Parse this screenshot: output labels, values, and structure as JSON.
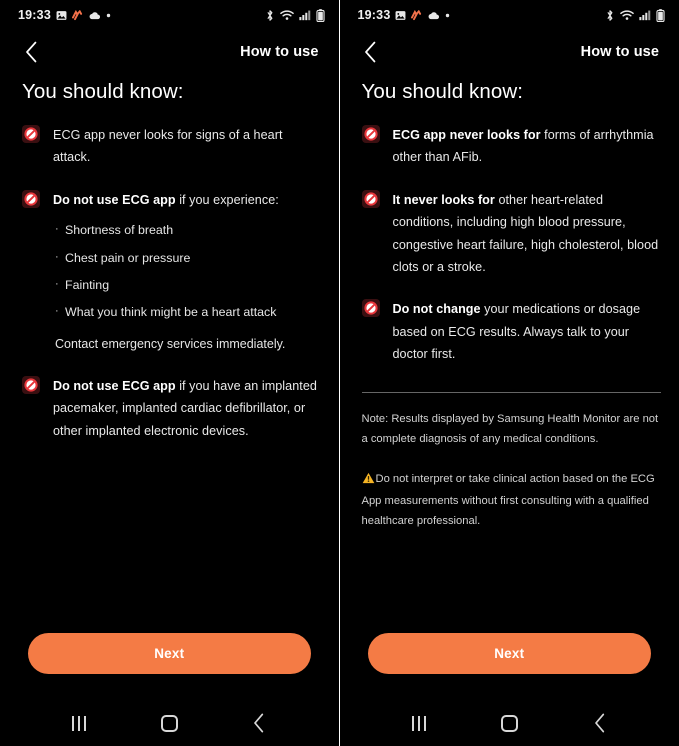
{
  "status_bar": {
    "time": "19:33",
    "left_icons": [
      "image-icon",
      "zigzag-orange-icon",
      "cloud-icon",
      "dot-icon"
    ],
    "right_icons": [
      "bluetooth-icon",
      "wifi-icon",
      "signal-icon",
      "battery-icon"
    ]
  },
  "colors": {
    "background": "#000000",
    "accent_orange": "#F47B45",
    "prohibition_red": "#E8363B",
    "warning_yellow": "#F5B425",
    "text_primary": "#ffffff",
    "text_secondary": "#d2d2d2"
  },
  "screens": [
    {
      "id": "screen-1",
      "header": {
        "back_label": "Back",
        "title": "How to use"
      },
      "page_title": "You should know:",
      "bullets": [
        {
          "icon": "prohibition-icon",
          "segments": [
            {
              "text": "ECG app never looks for signs of a heart attack.",
              "bold": false
            }
          ],
          "sub_items": [],
          "trailing_text": ""
        },
        {
          "icon": "prohibition-icon",
          "segments": [
            {
              "text": "Do not use ECG app ",
              "bold": true
            },
            {
              "text": "if you experience:",
              "bold": false
            }
          ],
          "sub_items": [
            "Shortness of breath",
            "Chest pain or pressure",
            "Fainting",
            "What you think might be a heart attack"
          ],
          "trailing_text": "Contact emergency services immediately."
        },
        {
          "icon": "prohibition-icon",
          "segments": [
            {
              "text": "Do not use ECG app ",
              "bold": true
            },
            {
              "text": "if you have an implanted pacemaker, implanted cardiac defibrillator, or other implanted electronic devices.",
              "bold": false
            }
          ],
          "sub_items": [],
          "trailing_text": ""
        }
      ],
      "divider": false,
      "note": "",
      "warning": "",
      "next_label": "Next"
    },
    {
      "id": "screen-2",
      "header": {
        "back_label": "Back",
        "title": "How to use"
      },
      "page_title": "You should know:",
      "bullets": [
        {
          "icon": "prohibition-icon",
          "segments": [
            {
              "text": "ECG app never looks for ",
              "bold": true
            },
            {
              "text": "forms of arrhythmia other than AFib.",
              "bold": false
            }
          ],
          "sub_items": [],
          "trailing_text": ""
        },
        {
          "icon": "prohibition-icon",
          "segments": [
            {
              "text": "It never looks for ",
              "bold": true
            },
            {
              "text": "other heart-related conditions, including high blood pressure, congestive heart failure, high cholesterol, blood clots or a stroke.",
              "bold": false
            }
          ],
          "sub_items": [],
          "trailing_text": ""
        },
        {
          "icon": "prohibition-icon",
          "segments": [
            {
              "text": "Do not change ",
              "bold": true
            },
            {
              "text": "your medications or dosage based on ECG results. Always talk to your doctor first.",
              "bold": false
            }
          ],
          "sub_items": [],
          "trailing_text": ""
        }
      ],
      "divider": true,
      "note": "Note: Results displayed by Samsung Health Monitor are not a complete diagnosis of any medical conditions.",
      "warning": "Do not interpret or take clinical action based on the ECG App measurements without first consulting with a qualified healthcare professional.",
      "warning_icon": "warning-triangle-icon",
      "next_label": "Next"
    }
  ],
  "nav_bar": {
    "recents_label": "Recents",
    "home_label": "Home",
    "back_label": "Back"
  }
}
